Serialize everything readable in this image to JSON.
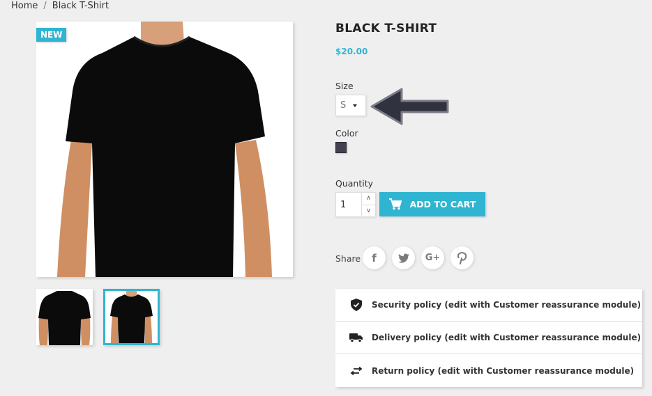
{
  "breadcrumb": [
    {
      "label": "Home"
    },
    {
      "label": "Black T-Shirt"
    }
  ],
  "breadcrumb_separator": "/",
  "product": {
    "badge": "NEW",
    "title": "BLACK T-SHIRT",
    "price": "$20.00",
    "accent_color": "#2fb5d2",
    "thumbnails": [
      {
        "label": "back view",
        "selected": false
      },
      {
        "label": "front view",
        "selected": true
      }
    ]
  },
  "variants": {
    "size_label": "Size",
    "size_value": "S",
    "color_label": "Color",
    "color_swatch": "#434050"
  },
  "purchase": {
    "quantity_label": "Quantity",
    "quantity_value": "1",
    "add_to_cart_label": "ADD TO CART"
  },
  "share": {
    "label": "Share",
    "networks": [
      {
        "name": "facebook",
        "glyph": "f"
      },
      {
        "name": "twitter",
        "glyph": "🐦"
      },
      {
        "name": "google-plus",
        "glyph": "G+"
      },
      {
        "name": "pinterest",
        "glyph": "P"
      }
    ]
  },
  "reassurance": [
    {
      "icon": "shield-check-icon",
      "text": "Security policy (edit with Customer reassurance module)"
    },
    {
      "icon": "truck-icon",
      "text": "Delivery policy (edit with Customer reassurance module)"
    },
    {
      "icon": "swap-arrows-icon",
      "text": "Return policy (edit with Customer reassurance module)"
    }
  ]
}
